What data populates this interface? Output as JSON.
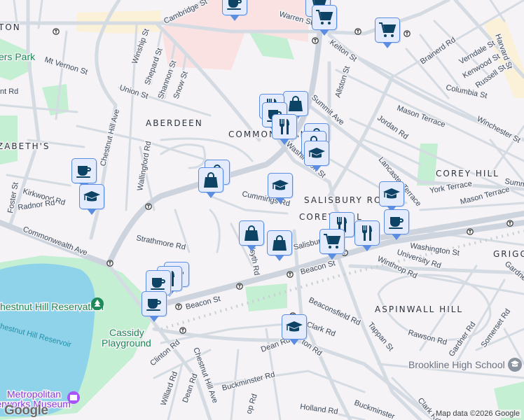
{
  "map": {
    "areas": {
      "allston": "TON",
      "aberdeen": "ABERDEEN",
      "commonwealth": "COMMONWEALTH",
      "elizabeths": "ZABETH'S",
      "corey_hill": "COREY HILL",
      "salisbury1": "SALISBURY ROAD -",
      "salisbury2": "COREY HILL",
      "aspinwall": "ASPINWALL HILL",
      "griggs": "GRIGGS"
    },
    "parks": {
      "rogers_park": "ers Park",
      "reservation": "Chestnut Hill Reservation",
      "cassidy1": "Cassidy",
      "cassidy2": "Playground",
      "reservoir": "Chestnut Hill Reservoir"
    },
    "poi": {
      "museum1": "Metropolitan",
      "museum2": "Waterworks Museum",
      "high_school": "Brookline High School"
    },
    "streets": {
      "cambridge": "Cambridge St",
      "mt_vernon": "Mt Vernon St",
      "winship": "Winship St",
      "shepard": "Shepard St",
      "shannon": "Shannon St",
      "snow": "Snow St",
      "union": "Union St",
      "nt_rd": "nt Rd",
      "chestnut_hill_ave": "Chestnut Hill Ave",
      "wallingford": "Wallingford Rd",
      "kirkwood": "Kirkwood Rd",
      "radnor": "Radnor Rd",
      "foster": "Foster St",
      "cummings": "Cummings Rd",
      "warren": "Warren St",
      "kelton": "Kelton St",
      "allston": "Allston St",
      "summit": "Summit Ave",
      "summit2": "Summit Ave",
      "brainerd": "Brainerd Rd",
      "verndale": "Verndale St",
      "kenwood": "Kenwood St",
      "russell": "Russell St",
      "columbia": "Columbia St",
      "harvard": "Harvard St",
      "mason": "Mason Terrace",
      "mason2": "Mason Terrace",
      "jordan": "Jordan Rd",
      "winchester": "Winchester St",
      "washington": "Washington St",
      "washington2": "Washington St",
      "lancaster": "Lancaster Terrace",
      "york": "York Terrace",
      "commonwealth_ave": "Commonwealth Ave",
      "strathmore": "Strathmore Rd",
      "beacon": "Beacon St",
      "beacon2": "Beacon St",
      "salisbury": "Salisbury Rd",
      "kilsyth": "Kilsyth Rd",
      "university": "University Rd",
      "winthrop": "Winthrop Rd",
      "gardner": "Gardner Rd",
      "gardner2": "Gardner Rd",
      "beaconsfield": "Beaconsfield Rd",
      "tappan": "Tappan St",
      "clark": "Clark Rd",
      "clark2": "Clark Rd",
      "dean": "Dean Rd",
      "dean2": "Dean Rd",
      "clinton": "Clinton Rd",
      "eliot": "ton Rd",
      "rawson": "Rawson Rd",
      "somerset": "Somerset Rd",
      "willard": "Willard Rd",
      "chestnut_hill_ave2": "Chestnut Hill Ave",
      "buckminster": "Buckminster Rd",
      "buckminster2": "Buckminster",
      "holland": "Holland Rd",
      "dudley": "op Rd"
    },
    "attribution": "Map data ©2026 Google",
    "logo": "Google",
    "colors": {
      "marker_bg": "#e3ebfc",
      "marker_border": "#5b8de0",
      "icon": "#0d4466",
      "water": "#8fd3ea",
      "park": "#c4efd3"
    }
  }
}
